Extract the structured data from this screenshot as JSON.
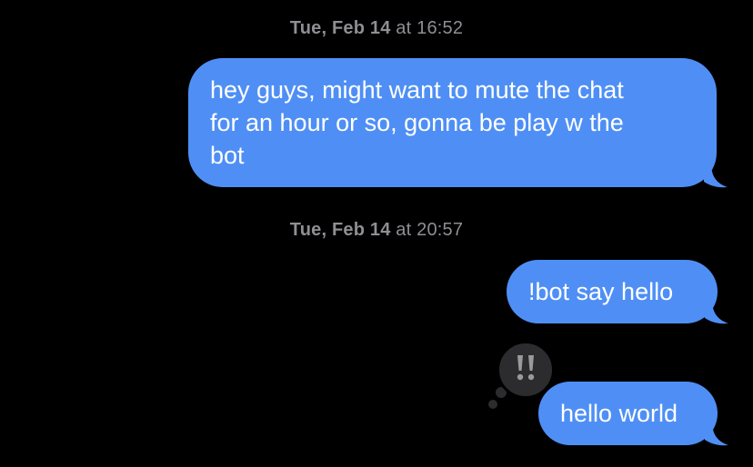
{
  "timestamps": [
    {
      "day": "Tue, Feb 14",
      "at": "at",
      "time": "16:52"
    },
    {
      "day": "Tue, Feb 14",
      "at": "at",
      "time": "20:57"
    }
  ],
  "messages": [
    {
      "lines": [
        "hey guys, might want to mute the chat",
        "for an hour or so, gonna be play w the",
        "bot"
      ],
      "sender": "me"
    },
    {
      "lines": [
        "!bot say hello"
      ],
      "sender": "me"
    },
    {
      "lines": [
        "hello world"
      ],
      "sender": "me",
      "reaction": "double-exclamation-icon"
    }
  ],
  "colors": {
    "background": "#000000",
    "bubble_outgoing": "#4f8ff5",
    "timestamp": "#8e8e93",
    "reaction_bg": "#2c2c2e",
    "reaction_glyph": "#9a9a9e"
  }
}
